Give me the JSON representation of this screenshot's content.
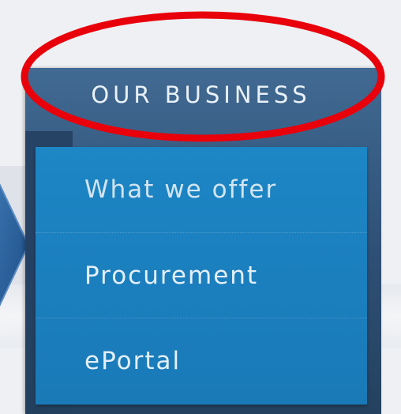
{
  "menu": {
    "header": "OUR BUSINESS",
    "items": [
      {
        "label": "What we offer"
      },
      {
        "label": "Procurement"
      },
      {
        "label": "ePortal"
      }
    ]
  },
  "icons": {
    "arrow": "arrow-right-icon"
  },
  "colors": {
    "panel": "#3a6189",
    "list": "#1d86c4",
    "annotation": "#e8000b",
    "arrow": "#1d4e86"
  }
}
